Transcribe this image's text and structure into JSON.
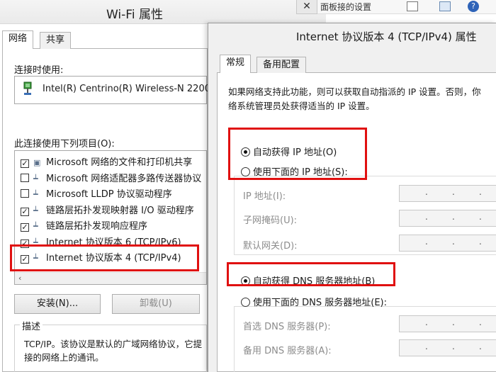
{
  "wifi_window": {
    "title": "Wi-Fi 属性",
    "close_glyph": "✕",
    "tabs": [
      {
        "label": "网络",
        "active": true
      },
      {
        "label": "共享",
        "active": false
      }
    ],
    "connect_label": "连接时使用:",
    "adapter_name": "Intel(R) Centrino(R) Wireless-N 2200",
    "items_label": "此连接使用下列项目(O):",
    "items": [
      {
        "checked": true,
        "label": "Microsoft 网络的文件和打印机共享"
      },
      {
        "checked": false,
        "label": "Microsoft 网络适配器多路传送器协议"
      },
      {
        "checked": false,
        "label": "Microsoft LLDP 协议驱动程序"
      },
      {
        "checked": true,
        "label": "链路层拓扑发现映射器 I/O 驱动程序"
      },
      {
        "checked": true,
        "label": "链路层拓扑发现响应程序"
      },
      {
        "checked": true,
        "label": "Internet 协议版本 6 (TCP/IPv6)"
      },
      {
        "checked": true,
        "label": "Internet 协议版本 4 (TCP/IPv4)"
      }
    ],
    "install_label": "安装(N)...",
    "uninstall_label": "卸载(U)",
    "desc_legend": "描述",
    "desc_line1": "TCP/IP。该协议是默认的广域网络协议，它提",
    "desc_line2": "接的网络上的通讯。"
  },
  "behind_window": {
    "partial_text": "面板接的设置"
  },
  "ipv4_window": {
    "title": "Internet 协议版本 4 (TCP/IPv4) 属性",
    "tabs": [
      {
        "label": "常规",
        "active": true
      },
      {
        "label": "备用配置",
        "active": false
      }
    ],
    "info_line1": "如果网络支持此功能，则可以获取自动指派的 IP 设置。否则，你",
    "info_line2": "络系统管理员处获得适当的 IP 设置。",
    "auto_ip_label": "自动获得 IP 地址(O)",
    "manual_ip_label": "使用下面的 IP 地址(S):",
    "ip_label": "IP 地址(I):",
    "mask_label": "子网掩码(U):",
    "gateway_label": "默认网关(D):",
    "auto_dns_label": "自动获得 DNS 服务器地址(B)",
    "manual_dns_label": "使用下面的 DNS 服务器地址(E):",
    "preferred_dns_label": "首选 DNS 服务器(P):",
    "alternate_dns_label": "备用 DNS 服务器(A):",
    "ip_dot": "."
  },
  "colors": {
    "highlight": "#e01010",
    "disabled_text": "#8c8c8c"
  }
}
